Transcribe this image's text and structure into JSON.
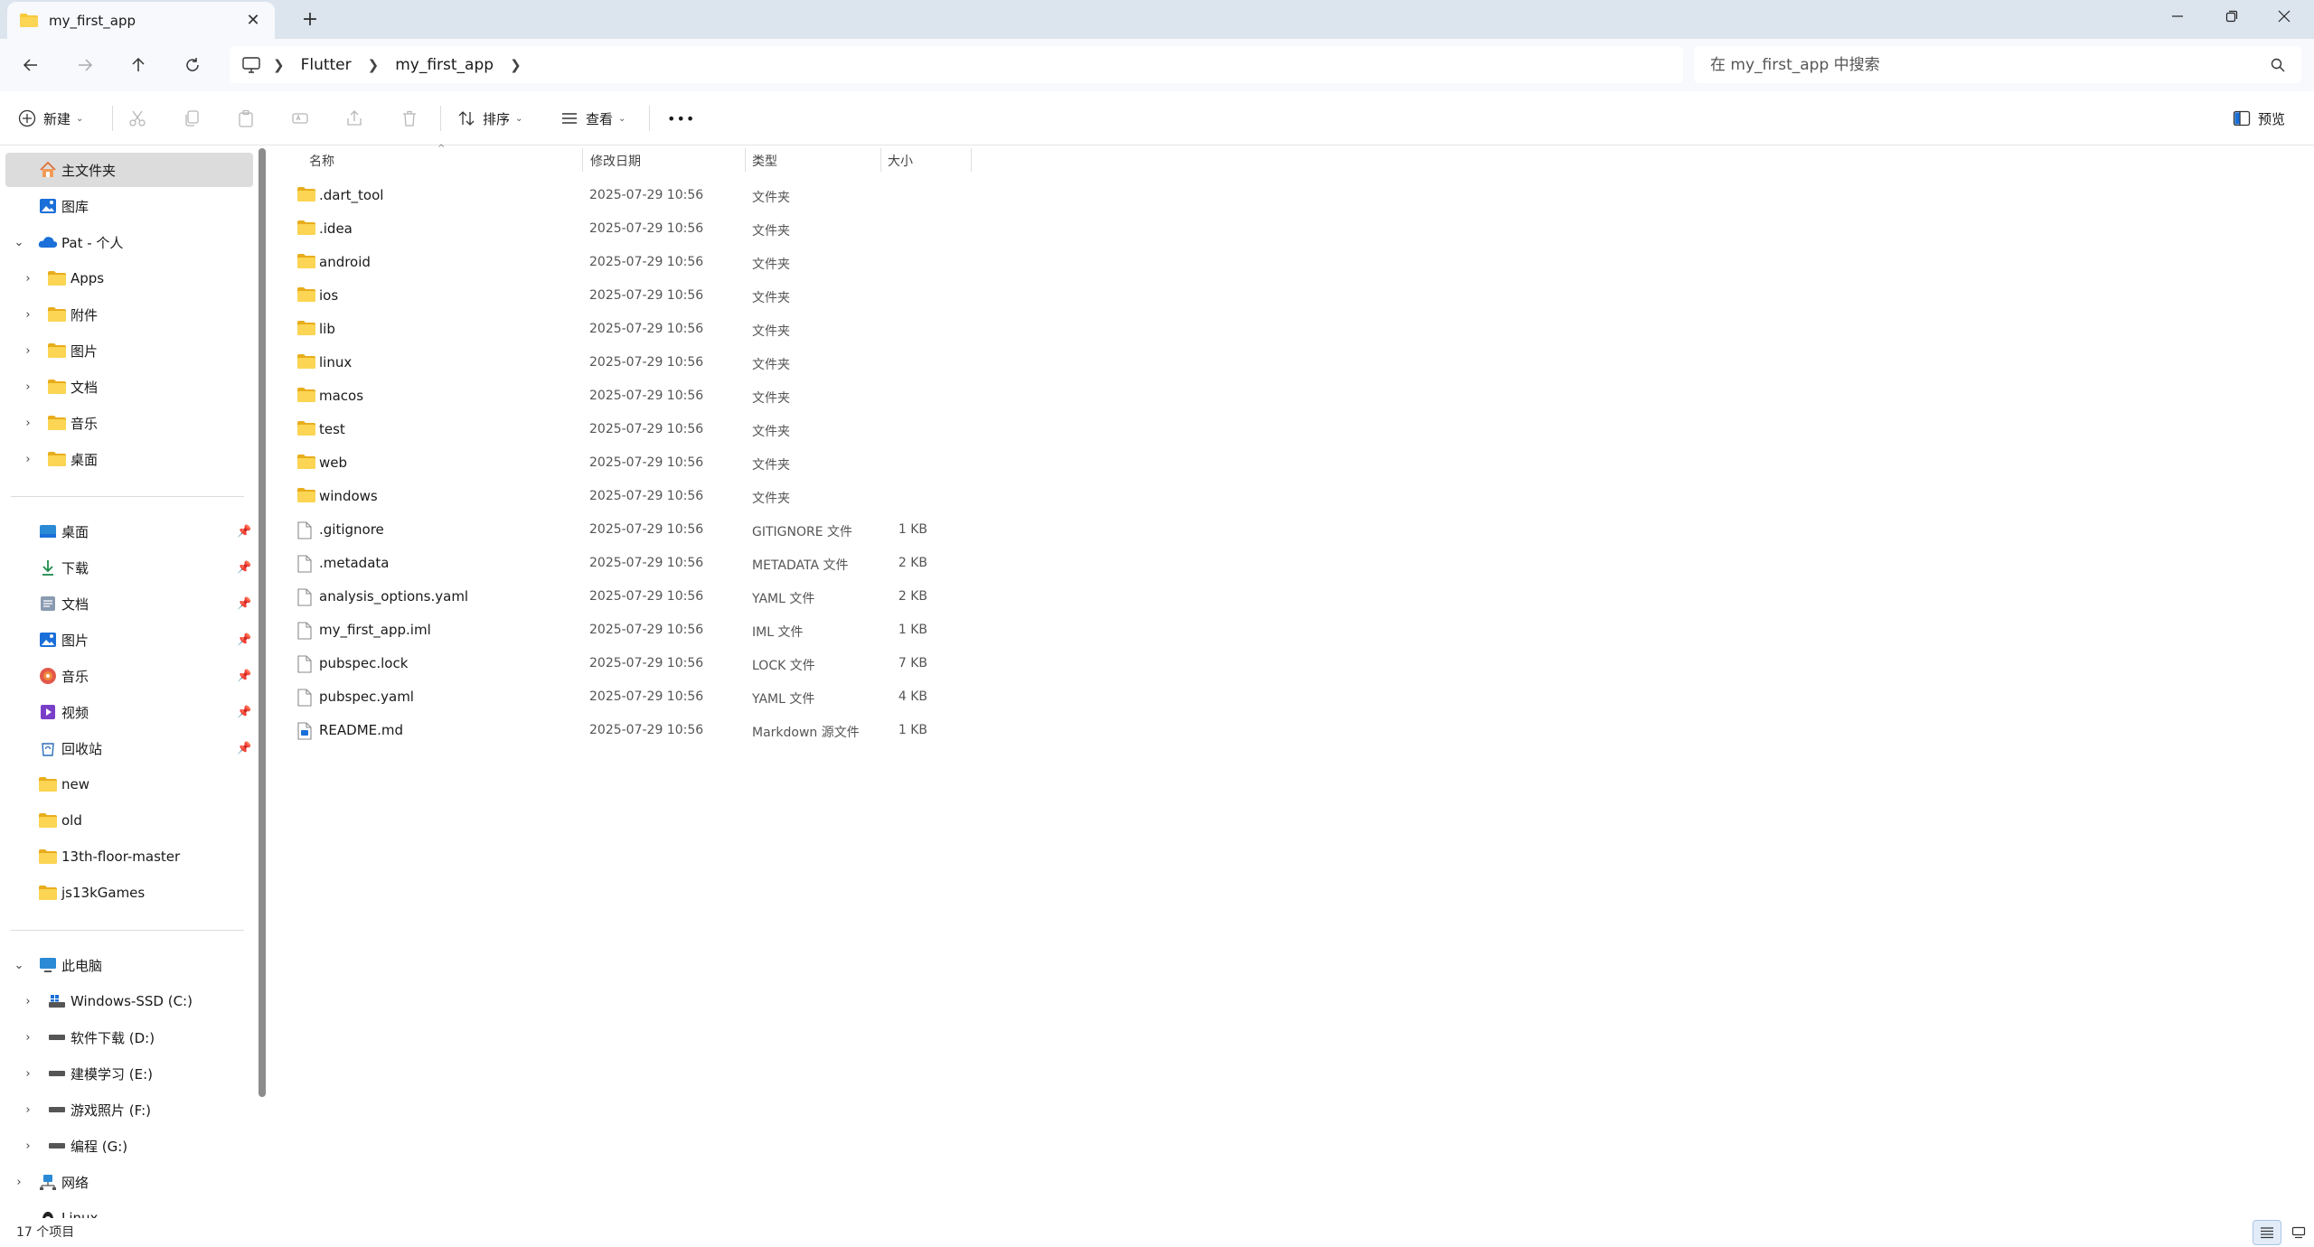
{
  "window": {
    "tab_title": "my_first_app",
    "new_tab": "+"
  },
  "address": {
    "breadcrumb": [
      "Flutter",
      "my_first_app"
    ],
    "search_placeholder": "在 my_first_app 中搜索"
  },
  "toolbar": {
    "new_label": "新建",
    "sort_label": "排序",
    "view_label": "查看",
    "more": "•••",
    "preview_label": "预览"
  },
  "sidebar": {
    "top": [
      {
        "label": "主文件夹",
        "icon": "home-icon",
        "selected": true
      },
      {
        "label": "图库",
        "icon": "gallery-icon"
      }
    ],
    "onedrive": {
      "label": "Pat - 个人",
      "icon": "cloud-icon",
      "children": [
        "Apps",
        "附件",
        "图片",
        "文档",
        "音乐",
        "桌面"
      ]
    },
    "quick_access": [
      {
        "label": "桌面",
        "icon": "desktop-icon",
        "pinned": true
      },
      {
        "label": "下载",
        "icon": "download-icon",
        "pinned": true
      },
      {
        "label": "文档",
        "icon": "documents-icon",
        "pinned": true
      },
      {
        "label": "图片",
        "icon": "pictures-icon",
        "pinned": true
      },
      {
        "label": "音乐",
        "icon": "music-icon",
        "pinned": true
      },
      {
        "label": "视频",
        "icon": "videos-icon",
        "pinned": true
      },
      {
        "label": "回收站",
        "icon": "recycle-bin-icon",
        "pinned": true
      },
      {
        "label": "new",
        "icon": "folder-icon"
      },
      {
        "label": "old",
        "icon": "folder-icon"
      },
      {
        "label": "13th-floor-master",
        "icon": "folder-icon"
      },
      {
        "label": "js13kGames",
        "icon": "folder-icon"
      }
    ],
    "this_pc": {
      "label": "此电脑",
      "icon": "computer-icon",
      "drives": [
        "Windows-SSD (C:)",
        "软件下载 (D:)",
        "建模学习 (E:)",
        "游戏照片 (F:)",
        "编程 (G:)"
      ]
    },
    "network": {
      "label": "网络",
      "icon": "network-icon"
    },
    "linux": {
      "label": "Linux",
      "icon": "linux-icon"
    }
  },
  "columns": {
    "name": "名称",
    "date": "修改日期",
    "type": "类型",
    "size": "大小"
  },
  "files": [
    {
      "name": ".dart_tool",
      "date": "2025-07-29 10:56",
      "type": "文件夹",
      "size": "",
      "kind": "folder"
    },
    {
      "name": ".idea",
      "date": "2025-07-29 10:56",
      "type": "文件夹",
      "size": "",
      "kind": "folder"
    },
    {
      "name": "android",
      "date": "2025-07-29 10:56",
      "type": "文件夹",
      "size": "",
      "kind": "folder"
    },
    {
      "name": "ios",
      "date": "2025-07-29 10:56",
      "type": "文件夹",
      "size": "",
      "kind": "folder"
    },
    {
      "name": "lib",
      "date": "2025-07-29 10:56",
      "type": "文件夹",
      "size": "",
      "kind": "folder"
    },
    {
      "name": "linux",
      "date": "2025-07-29 10:56",
      "type": "文件夹",
      "size": "",
      "kind": "folder"
    },
    {
      "name": "macos",
      "date": "2025-07-29 10:56",
      "type": "文件夹",
      "size": "",
      "kind": "folder"
    },
    {
      "name": "test",
      "date": "2025-07-29 10:56",
      "type": "文件夹",
      "size": "",
      "kind": "folder"
    },
    {
      "name": "web",
      "date": "2025-07-29 10:56",
      "type": "文件夹",
      "size": "",
      "kind": "folder"
    },
    {
      "name": "windows",
      "date": "2025-07-29 10:56",
      "type": "文件夹",
      "size": "",
      "kind": "folder"
    },
    {
      "name": ".gitignore",
      "date": "2025-07-29 10:56",
      "type": "GITIGNORE 文件",
      "size": "1 KB",
      "kind": "file"
    },
    {
      "name": ".metadata",
      "date": "2025-07-29 10:56",
      "type": "METADATA 文件",
      "size": "2 KB",
      "kind": "file"
    },
    {
      "name": "analysis_options.yaml",
      "date": "2025-07-29 10:56",
      "type": "YAML 文件",
      "size": "2 KB",
      "kind": "file"
    },
    {
      "name": "my_first_app.iml",
      "date": "2025-07-29 10:56",
      "type": "IML 文件",
      "size": "1 KB",
      "kind": "file"
    },
    {
      "name": "pubspec.lock",
      "date": "2025-07-29 10:56",
      "type": "LOCK 文件",
      "size": "7 KB",
      "kind": "file"
    },
    {
      "name": "pubspec.yaml",
      "date": "2025-07-29 10:56",
      "type": "YAML 文件",
      "size": "4 KB",
      "kind": "file"
    },
    {
      "name": "README.md",
      "date": "2025-07-29 10:56",
      "type": "Markdown 源文件",
      "size": "1 KB",
      "kind": "markdown"
    }
  ],
  "status": {
    "item_count": "17 个项目"
  },
  "colors": {
    "folder": "#f8c93a",
    "folder_dark": "#e8ad1c",
    "accent": "#1a6fd8",
    "selected_row": "#dcdcdc",
    "titlebar": "#dce4ee"
  }
}
